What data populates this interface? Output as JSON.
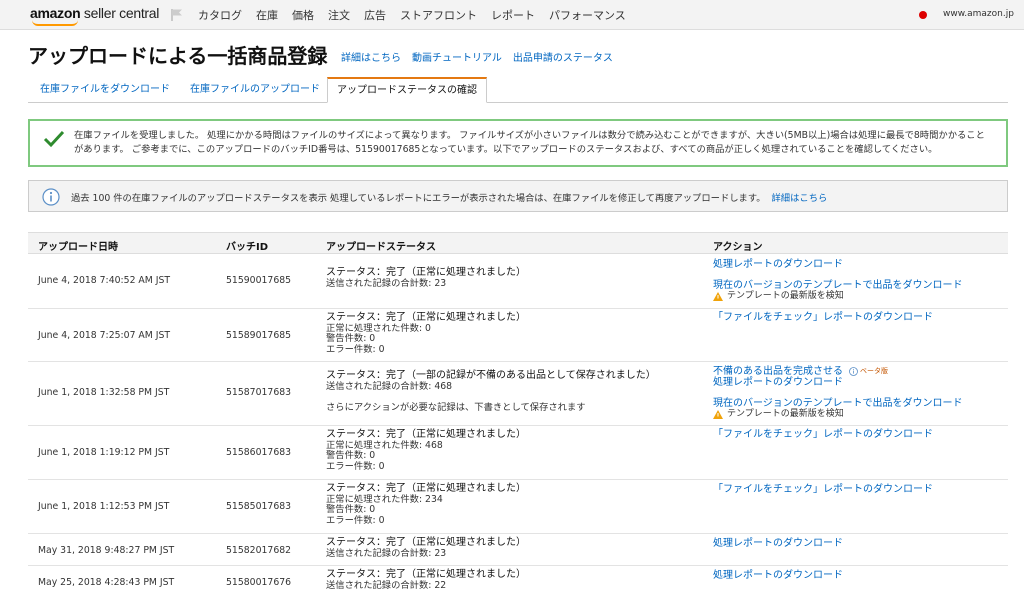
{
  "nav": {
    "logo_amazon": "amazon",
    "logo_sc": " seller central",
    "items": [
      "カタログ",
      "在庫",
      "価格",
      "注文",
      "広告",
      "ストアフロント",
      "レポート",
      "パフォーマンス"
    ],
    "site": "www.amazon.jp"
  },
  "header": {
    "title": "アップロードによる一括商品登録",
    "links": [
      "詳細はこちら",
      "動画チュートリアル",
      "出品申請のステータス"
    ]
  },
  "tabs": [
    "在庫ファイルをダウンロード",
    "在庫ファイルのアップロード",
    "アップロードステータスの確認"
  ],
  "success_message": "在庫ファイルを受理しました。 処理にかかる時間はファイルのサイズによって異なります。 ファイルサイズが小さいファイルは数分で読み込むことができますが、大きい(5MB以上)場合は処理に最長で8時間かかることがあります。 ご参考までに、このアップロードのバッチID番号は、51590017685となっています。以下でアップロードのステータスおよび、すべての商品が正しく処理されていることを確認してください。",
  "info": {
    "text": "過去 100 件の在庫ファイルのアップロードステータスを表示 処理しているレポートにエラーが表示された場合は、在庫ファイルを修正して再度アップロードします。",
    "link": "詳細はこちら"
  },
  "table": {
    "headers": [
      "アップロード日時",
      "バッチID",
      "アップロードステータス",
      "アクション"
    ],
    "rows": [
      {
        "date": "June 4, 2018 7:40:52 AM JST",
        "batch": "51590017685",
        "status": [
          "ステータス：完了（正常に処理されました）",
          "送信された記録の合計数: 23"
        ],
        "actions": [
          "処理レポートのダウンロード",
          "現在のバージョンのテンプレートで出品をダウンロード"
        ],
        "warning": "テンプレートの最新版を検知"
      },
      {
        "date": "June 4, 2018 7:25:07 AM JST",
        "batch": "51589017685",
        "status": [
          "ステータス：完了（正常に処理されました）",
          "正常に処理された件数: 0",
          "警告件数: 0",
          "エラー件数: 0"
        ],
        "actions": [
          "「ファイルをチェック」レポートのダウンロード"
        ]
      },
      {
        "date": "June 1, 2018 1:32:58 PM JST",
        "batch": "51587017683",
        "status": [
          "ステータス：完了（一部の記録が不備のある出品として保存されました）",
          "送信された記録の合計数: 468",
          "さらにアクションが必要な記録は、下書きとして保存されます"
        ],
        "actions": [
          "不備のある出品を完成させる",
          "処理レポートのダウンロード",
          "現在のバージョンのテンプレートで出品をダウンロード"
        ],
        "beta": "ベータ版",
        "warning": "テンプレートの最新版を検知"
      },
      {
        "date": "June 1, 2018 1:19:12 PM JST",
        "batch": "51586017683",
        "status": [
          "ステータス：完了（正常に処理されました）",
          "正常に処理された件数: 468",
          "警告件数: 0",
          "エラー件数: 0"
        ],
        "actions": [
          "「ファイルをチェック」レポートのダウンロード"
        ]
      },
      {
        "date": "June 1, 2018 1:12:53 PM JST",
        "batch": "51585017683",
        "status": [
          "ステータス：完了（正常に処理されました）",
          "正常に処理された件数: 234",
          "警告件数: 0",
          "エラー件数: 0"
        ],
        "actions": [
          "「ファイルをチェック」レポートのダウンロード"
        ]
      },
      {
        "date": "May 31, 2018 9:48:27 PM JST",
        "batch": "51582017682",
        "status": [
          "ステータス：完了（正常に処理されました）",
          "送信された記録の合計数: 23"
        ],
        "actions": [
          "処理レポートのダウンロード"
        ]
      },
      {
        "date": "May 25, 2018 4:28:43 PM JST",
        "batch": "51580017676",
        "status": [
          "ステータス：完了（正常に処理されました）",
          "送信された記録の合計数: 22"
        ],
        "actions": [
          "処理レポートのダウンロード"
        ]
      }
    ]
  },
  "colors": {
    "link": "#0066c0",
    "success_border": "#7fc97f",
    "check": "#2e8b2e",
    "tab_accent": "#e47911"
  }
}
